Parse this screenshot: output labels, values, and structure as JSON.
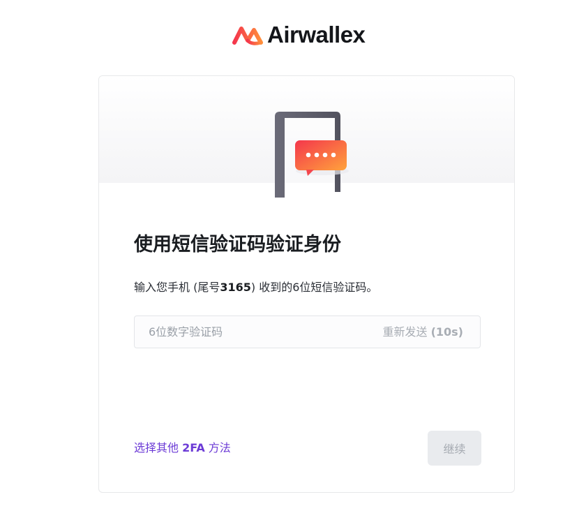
{
  "brand": {
    "name": "Airwallex",
    "icon": "airwallex-logo-icon",
    "colors": {
      "gradient_start": "#f4364c",
      "gradient_end": "#ff8e3c"
    }
  },
  "verification": {
    "illustration_icon": "phone-sms-icon",
    "title": "使用短信验证码验证身份",
    "description_prefix": "输入您手机 (尾号",
    "phone_suffix": "3165",
    "description_suffix": ") 收到的6位短信验证码。",
    "code_placeholder": "6位数字验证码",
    "code_value": "",
    "resend_label": "重新发送",
    "resend_countdown": "(10s)",
    "alt_method_prefix": "选择其他 ",
    "alt_method_bold": "2FA",
    "alt_method_suffix": " 方法",
    "continue_label": "继续",
    "colors": {
      "link": "#6c3bd6",
      "disabled_button_bg": "#e9ebee"
    }
  }
}
